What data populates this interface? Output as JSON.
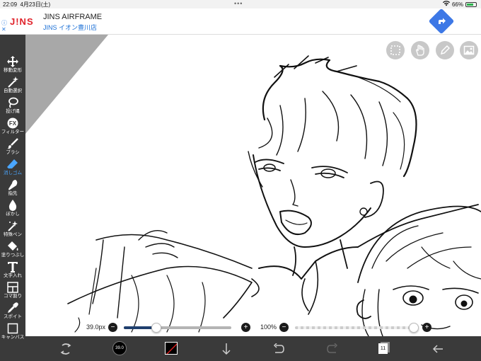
{
  "status": {
    "time": "22:09",
    "date": "4月23日(土)",
    "battery": "66%",
    "battery_level": 0.66
  },
  "ad": {
    "adchoice": "ⓘ\n✕",
    "logo": "J!NS",
    "title": "JINS AIRFRAME",
    "subtitle": "JINS イオン豊川店"
  },
  "sidebar": {
    "tools": [
      {
        "label": "移動変形",
        "icon": "move-icon"
      },
      {
        "label": "自動選択",
        "icon": "magic-wand-icon"
      },
      {
        "label": "投げ縄",
        "icon": "lasso-icon"
      },
      {
        "label": "フィルター",
        "icon": "fx-icon"
      },
      {
        "label": "ブラシ",
        "icon": "brush-icon"
      },
      {
        "label": "消しゴム",
        "icon": "eraser-icon",
        "active": true
      },
      {
        "label": "指先",
        "icon": "finger-icon"
      },
      {
        "label": "ぼかし",
        "icon": "blur-drop-icon"
      },
      {
        "label": "特殊ペン",
        "icon": "special-pen-icon"
      },
      {
        "label": "塗りつぶし",
        "icon": "fill-icon"
      },
      {
        "label": "文字入れ",
        "icon": "text-icon"
      },
      {
        "label": "コマ割り",
        "icon": "frame-divide-icon"
      },
      {
        "label": "スポイト",
        "icon": "eyedropper-icon"
      },
      {
        "label": "キャンバス",
        "icon": "canvas-icon"
      }
    ]
  },
  "brush": {
    "size_label": "39.0px",
    "size_fill": 0.3,
    "opacity_label": "100%",
    "opacity_fill": 1.0
  },
  "brush_preview": "39.0",
  "layers_count": "11",
  "colors": {
    "accent": "#4aa6ff",
    "toolbar": "#3a3a3a",
    "active_color": "#000000"
  }
}
